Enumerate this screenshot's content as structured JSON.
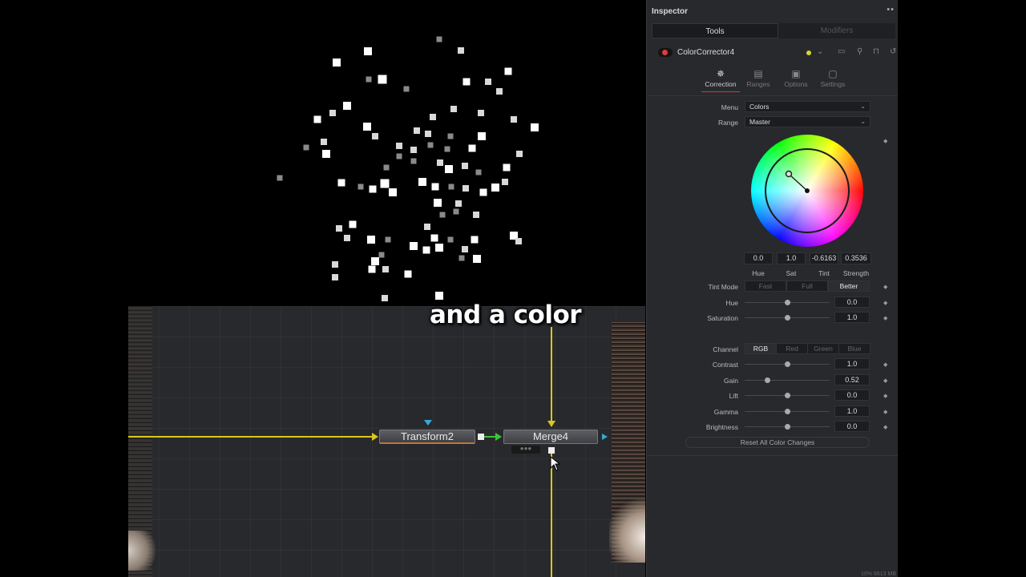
{
  "caption": "and a color",
  "inspector": {
    "title": "Inspector",
    "menu_icon": "••",
    "tabs": {
      "tools": "Tools",
      "modifiers": "Modifiers"
    },
    "tool": {
      "name": "ColorCorrector4",
      "color_dot": "#e23b3b",
      "pin_indicator": "#d8d82a"
    },
    "subtabs": [
      {
        "label": "Correction",
        "icon": "correction-icon",
        "glyph": "✵"
      },
      {
        "label": "Ranges",
        "icon": "ranges-icon",
        "glyph": "▤"
      },
      {
        "label": "Options",
        "icon": "options-icon",
        "glyph": "▣"
      },
      {
        "label": "Settings",
        "icon": "settings-icon",
        "glyph": "▢"
      }
    ],
    "menu": {
      "label": "Menu",
      "value": "Colors"
    },
    "range": {
      "label": "Range",
      "value": "Master"
    },
    "wheel_values": [
      {
        "value": "0.0",
        "label": "Hue"
      },
      {
        "value": "1.0",
        "label": "Sat"
      },
      {
        "value": "-0.6163",
        "label": "Tint"
      },
      {
        "value": "0.3536",
        "label": "Strength"
      }
    ],
    "tint_mode": {
      "label": "Tint Mode",
      "options": [
        "Fast",
        "Full",
        "Better"
      ],
      "selected": "Better"
    },
    "hue": {
      "label": "Hue",
      "value": "0.0",
      "level": 0.5
    },
    "saturation": {
      "label": "Saturation",
      "value": "1.0",
      "level": 0.5
    },
    "channel": {
      "label": "Channel",
      "options": [
        "RGB",
        "Red",
        "Green",
        "Blue"
      ],
      "selected": "RGB"
    },
    "controls": [
      {
        "label": "Contrast",
        "value": "1.0",
        "level": 0.5
      },
      {
        "label": "Gain",
        "value": "0.52",
        "level": 0.27
      },
      {
        "label": "Lift",
        "value": "0.0",
        "level": 0.5
      },
      {
        "label": "Gamma",
        "value": "1.0",
        "level": 0.5
      },
      {
        "label": "Brightness",
        "value": "0.0",
        "level": 0.5
      }
    ],
    "reset_label": "Reset All Color Changes",
    "status": "10%   6613 MB"
  },
  "nodes": {
    "transform": "Transform2",
    "merge": "Merge4",
    "merge_bar": "●●●"
  },
  "colors": {
    "wire_yellow": "#d8c81e",
    "wire_green": "#3cc33c",
    "port_blue": "#3aa7d8",
    "active_tab_underline": "#dd3333"
  }
}
